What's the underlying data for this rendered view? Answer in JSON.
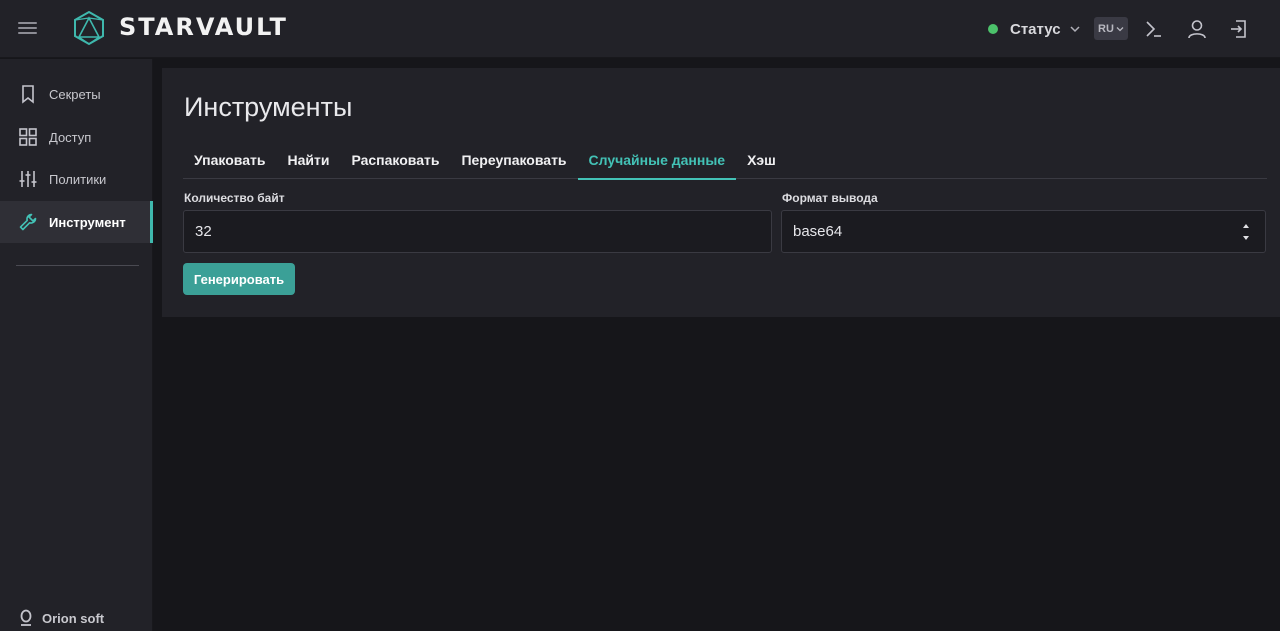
{
  "header": {
    "logo_text": "STARVAULT",
    "status_label": "Статус",
    "status_color": "#4cc26b",
    "lang": "RU",
    "icons": [
      "menu-icon",
      "terminal-icon",
      "user-icon",
      "logout-icon"
    ]
  },
  "sidebar": {
    "items": [
      {
        "label": "Секреты",
        "icon": "bookmark-icon"
      },
      {
        "label": "Доступ",
        "icon": "grid-icon"
      },
      {
        "label": "Политики",
        "icon": "sliders-icon"
      },
      {
        "label": "Инструмент",
        "icon": "wrench-icon",
        "active": true
      }
    ],
    "footer": "Orion soft"
  },
  "main": {
    "title": "Инструменты",
    "tabs": [
      {
        "label": "Упаковать"
      },
      {
        "label": "Найти"
      },
      {
        "label": "Распаковать"
      },
      {
        "label": "Переупаковать"
      },
      {
        "label": "Случайные данные",
        "active": true
      },
      {
        "label": "Хэш"
      }
    ],
    "bytes_label": "Количество байт",
    "bytes_value": "32",
    "format_label": "Формат вывода",
    "format_value": "base64",
    "generate_label": "Генерировать"
  },
  "colors": {
    "accent": "#43c2b6",
    "button": "#3ba097",
    "background": "#16161a",
    "panel": "#222228"
  }
}
